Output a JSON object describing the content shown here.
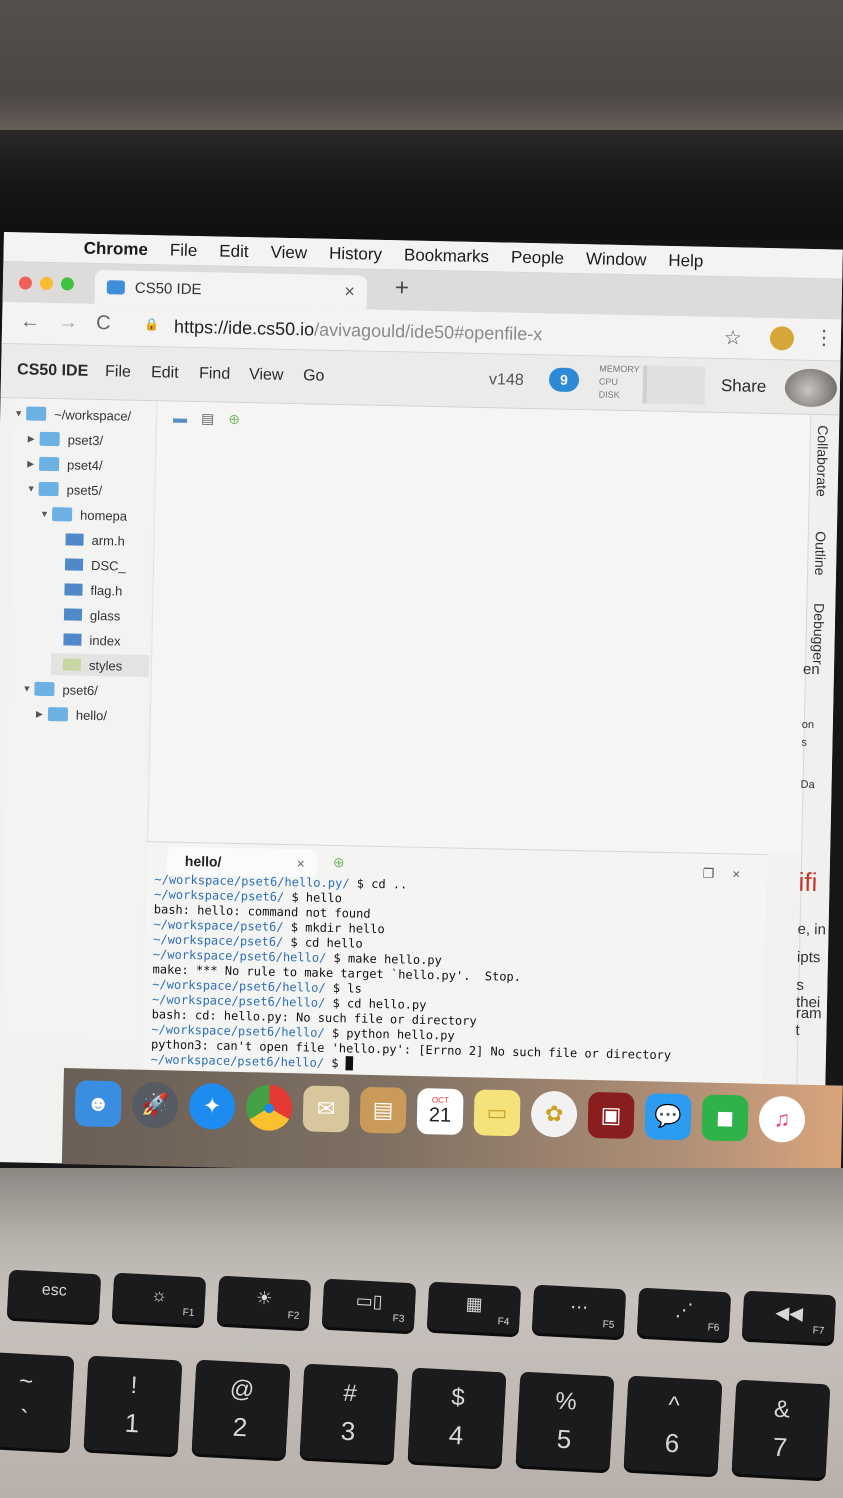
{
  "menubar": {
    "app": "Chrome",
    "items": [
      "File",
      "Edit",
      "View",
      "History",
      "Bookmarks",
      "People",
      "Window",
      "Help"
    ]
  },
  "browser": {
    "tab_title": "CS50 IDE",
    "url_host": "https://ide.cs50.io",
    "url_path": "/avivagould/ide50#openfile-x"
  },
  "ide": {
    "brand": "CS50 IDE",
    "menu": [
      "File",
      "Edit",
      "Find",
      "View",
      "Go"
    ],
    "version": "v148",
    "notifications": "9",
    "meters": [
      "MEMORY",
      "CPU",
      "DISK"
    ],
    "share": "Share"
  },
  "tree": [
    {
      "label": "~/workspace/",
      "depth": 0,
      "kind": "folder",
      "open": true
    },
    {
      "label": "pset3/",
      "depth": 1,
      "kind": "folder",
      "open": false
    },
    {
      "label": "pset4/",
      "depth": 1,
      "kind": "folder",
      "open": false
    },
    {
      "label": "pset5/",
      "depth": 1,
      "kind": "folder",
      "open": true
    },
    {
      "label": "homepa",
      "depth": 2,
      "kind": "folder",
      "open": true
    },
    {
      "label": "arm.h",
      "depth": 3,
      "kind": "file"
    },
    {
      "label": "DSC_",
      "depth": 3,
      "kind": "file"
    },
    {
      "label": "flag.h",
      "depth": 3,
      "kind": "file"
    },
    {
      "label": "glass",
      "depth": 3,
      "kind": "file"
    },
    {
      "label": "index",
      "depth": 3,
      "kind": "file"
    },
    {
      "label": "styles",
      "depth": 3,
      "kind": "css",
      "selected": true
    },
    {
      "label": "pset6/",
      "depth": 1,
      "kind": "folder",
      "open": true
    },
    {
      "label": "hello/",
      "depth": 2,
      "kind": "folder",
      "open": false
    }
  ],
  "side_panels": [
    "Collaborate",
    "Outline",
    "Debugger"
  ],
  "terminal": {
    "tab_label": "hello/",
    "lines": [
      [
        "~/workspace/pset6/hello.py/",
        " $ cd .."
      ],
      [
        "~/workspace/pset6/",
        " $ hello"
      ],
      [
        "",
        "bash: hello: command not found"
      ],
      [
        "~/workspace/pset6/",
        " $ mkdir hello"
      ],
      [
        "~/workspace/pset6/",
        " $ cd hello"
      ],
      [
        "~/workspace/pset6/hello/",
        " $ make hello.py"
      ],
      [
        "",
        "make: *** No rule to make target `hello.py'.  Stop."
      ],
      [
        "~/workspace/pset6/hello/",
        " $ ls"
      ],
      [
        "~/workspace/pset6/hello/",
        " $ cd hello.py"
      ],
      [
        "",
        "bash: cd: hello.py: No such file or directory"
      ],
      [
        "~/workspace/pset6/hello/",
        " $ python hello.py"
      ],
      [
        "",
        "python3: can't open file 'hello.py': [Errno 2] No such file or directory"
      ],
      [
        "~/workspace/pset6/hello/",
        " $ █"
      ]
    ]
  },
  "background_window_fragments": [
    "en",
    "on",
    "s",
    "Da",
    "ifi",
    "e, in",
    "ipts",
    "s thei",
    "ram t"
  ],
  "dock": {
    "calendar_month": "OCT",
    "calendar_day": "21",
    "apps": [
      "finder-icon",
      "launchpad-icon",
      "safari-icon",
      "chrome-icon",
      "mail-icon",
      "contacts-icon",
      "calendar-icon",
      "notes-icon",
      "photos-icon",
      "photo-booth-icon",
      "messages-icon",
      "facetime-icon",
      "itunes-icon"
    ]
  },
  "keyboard": {
    "function_row": [
      {
        "glyph": "esc",
        "label": ""
      },
      {
        "glyph": "☼",
        "label": "F1"
      },
      {
        "glyph": "☀",
        "label": "F2"
      },
      {
        "glyph": "▭▯",
        "label": "F3"
      },
      {
        "glyph": "▦",
        "label": "F4"
      },
      {
        "glyph": "⋯",
        "label": "F5"
      },
      {
        "glyph": "⋰",
        "label": "F6"
      },
      {
        "glyph": "◀◀",
        "label": "F7"
      }
    ],
    "number_row": [
      {
        "top": "~",
        "bottom": "`"
      },
      {
        "top": "!",
        "bottom": "1"
      },
      {
        "top": "@",
        "bottom": "2"
      },
      {
        "top": "#",
        "bottom": "3"
      },
      {
        "top": "$",
        "bottom": "4"
      },
      {
        "top": "%",
        "bottom": "5"
      },
      {
        "top": "^",
        "bottom": "6"
      },
      {
        "top": "&",
        "bottom": "7"
      }
    ]
  }
}
